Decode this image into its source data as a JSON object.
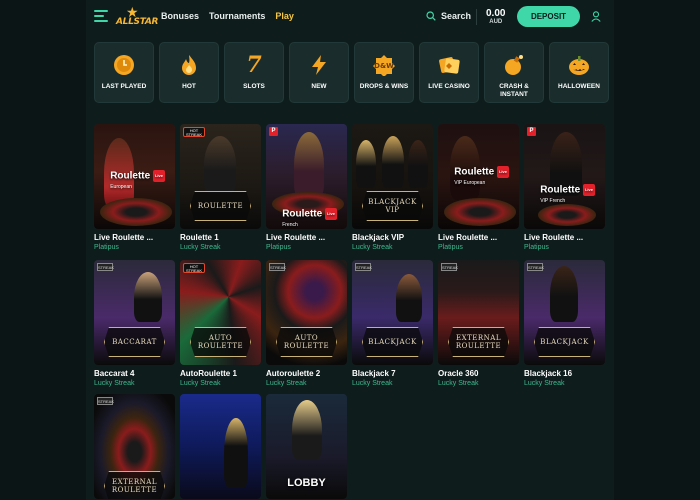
{
  "header": {
    "logo_text": "ALLSTAR",
    "nav": [
      {
        "label": "Bonuses",
        "active": false
      },
      {
        "label": "Tournaments",
        "active": false
      },
      {
        "label": "Play",
        "active": true
      }
    ],
    "search_label": "Search",
    "balance_amount": "0.00",
    "balance_currency": "AUD",
    "deposit_label": "DEPOSIT"
  },
  "categories": [
    {
      "label": "LAST PLAYED",
      "icon": "clock-coin-icon"
    },
    {
      "label": "HOT",
      "icon": "flame-icon"
    },
    {
      "label": "SLOTS",
      "icon": "seven-icon"
    },
    {
      "label": "NEW",
      "icon": "lightning-icon"
    },
    {
      "label": "DROPS & WINS",
      "icon": "drops-wins-icon"
    },
    {
      "label": "LIVE CASINO",
      "icon": "cards-icon"
    },
    {
      "label": "CRASH & INSTANT",
      "icon": "bomb-icon"
    },
    {
      "label": "HALLOWEEN",
      "icon": "pumpkin-icon"
    }
  ],
  "games": [
    {
      "name": "Live Roulette ...",
      "provider": "Platipus",
      "art": "Roulette",
      "art_sub": "European"
    },
    {
      "name": "Roulette 1",
      "provider": "Lucky Streak",
      "art": "ROULETTE"
    },
    {
      "name": "Live Roulette ...",
      "provider": "Platipus",
      "art": "Roulette",
      "art_sub": "French"
    },
    {
      "name": "Blackjack VIP",
      "provider": "Lucky Streak",
      "art": "BLACKJACK VIP"
    },
    {
      "name": "Live Roulette ...",
      "provider": "Platipus",
      "art": "Roulette",
      "art_sub": "VIP European"
    },
    {
      "name": "Live Roulette ...",
      "provider": "Platipus",
      "art": "Roulette",
      "art_sub": "VIP French"
    },
    {
      "name": "Baccarat 4",
      "provider": "Lucky Streak",
      "art": "BACCARAT"
    },
    {
      "name": "AutoRoulette 1",
      "provider": "Lucky Streak",
      "art": "AUTO ROULETTE"
    },
    {
      "name": "Autoroulette 2",
      "provider": "Lucky Streak",
      "art": "AUTO ROULETTE"
    },
    {
      "name": "Blackjack 7",
      "provider": "Lucky Streak",
      "art": "BLACKJACK"
    },
    {
      "name": "Oracle 360",
      "provider": "Lucky Streak",
      "art": "EXTERNAL ROULETTE"
    },
    {
      "name": "Blackjack 16",
      "provider": "Lucky Streak",
      "art": "BLACKJACK"
    },
    {
      "name": "",
      "provider": "",
      "art": "EXTERNAL ROULETTE"
    },
    {
      "name": "",
      "provider": "",
      "art": ""
    },
    {
      "name": "",
      "provider": "",
      "art": "LOBBY"
    }
  ],
  "badges": {
    "p": "P",
    "hot": "HOT",
    "streak": "STREAK",
    "live": "Live"
  },
  "colors": {
    "accent": "#3fd7a8",
    "active_nav": "#f5c744",
    "provider": "#3fb98f",
    "background": "#0f1c1c"
  }
}
